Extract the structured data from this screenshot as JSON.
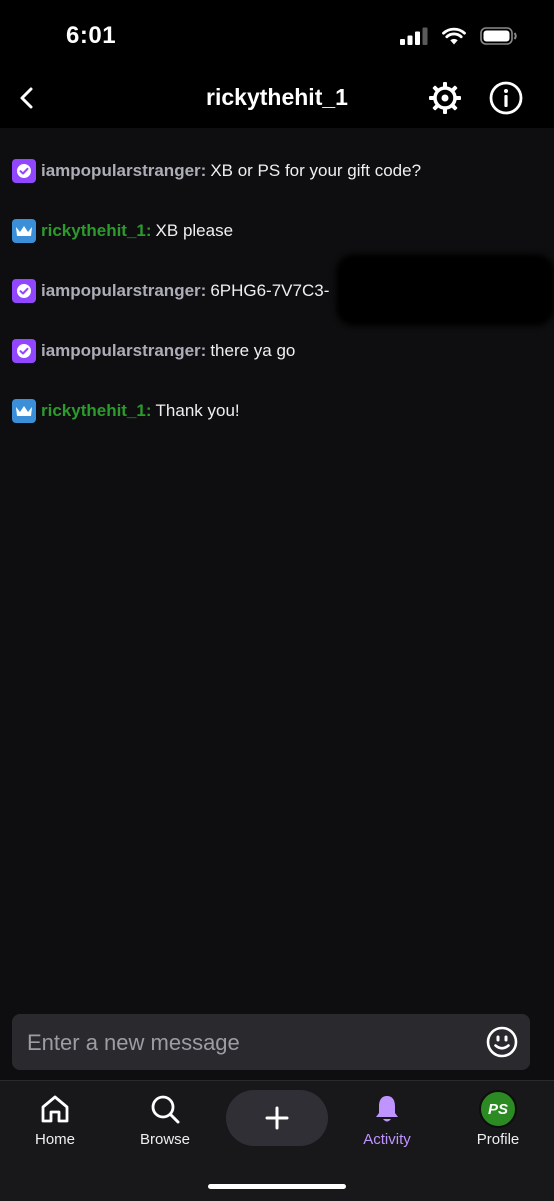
{
  "status_bar": {
    "time": "6:01"
  },
  "header": {
    "title": "rickythehit_1"
  },
  "messages": [
    {
      "user": "iampopularstranger:",
      "text": "XB or PS for your gift code?",
      "badge": "verified"
    },
    {
      "user": "rickythehit_1:",
      "text": "XB please",
      "badge": "crown"
    },
    {
      "user": "iampopularstranger:",
      "text": "6PHG6-7V7C3-",
      "badge": "verified"
    },
    {
      "user": "iampopularstranger:",
      "text": "there ya go",
      "badge": "verified"
    },
    {
      "user": "rickythehit_1:",
      "text": "Thank you!",
      "badge": "crown"
    }
  ],
  "composer": {
    "placeholder": "Enter a new message"
  },
  "nav": {
    "home": "Home",
    "browse": "Browse",
    "activity": "Activity",
    "profile": "Profile",
    "avatar_text": "PS"
  },
  "colors": {
    "accent": "#9147ff",
    "active_tab": "#bf94ff",
    "username_green": "#2c9a2c"
  }
}
